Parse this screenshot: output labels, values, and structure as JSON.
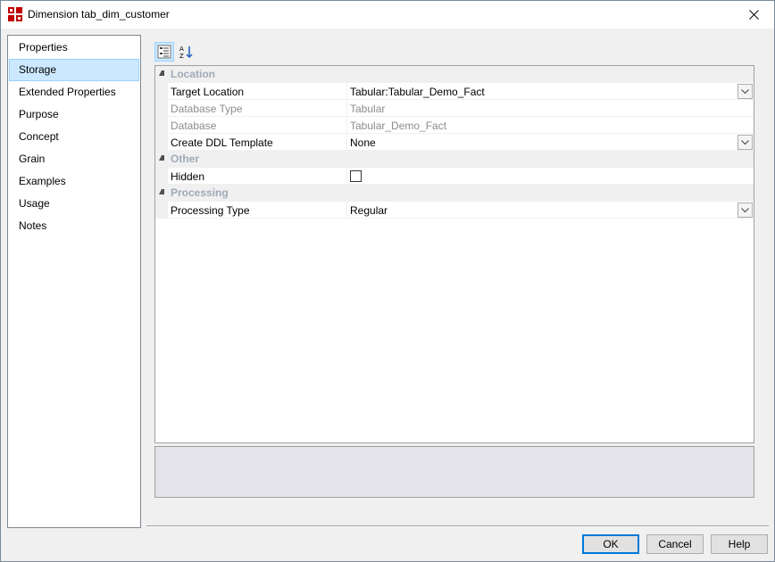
{
  "window": {
    "title": "Dimension tab_dim_customer",
    "accent_color": "#c00000"
  },
  "nav": {
    "items": [
      {
        "label": "Properties",
        "selected": false
      },
      {
        "label": "Storage",
        "selected": true
      },
      {
        "label": "Extended Properties",
        "selected": false
      },
      {
        "label": "Purpose",
        "selected": false
      },
      {
        "label": "Concept",
        "selected": false
      },
      {
        "label": "Grain",
        "selected": false
      },
      {
        "label": "Examples",
        "selected": false
      },
      {
        "label": "Usage",
        "selected": false
      },
      {
        "label": "Notes",
        "selected": false
      }
    ]
  },
  "toolbar": {
    "categorized_icon": "categorized-view-icon",
    "alphabetical_icon": "sort-alphabetical-icon"
  },
  "grid": {
    "categories": [
      {
        "label": "Location",
        "rows": [
          {
            "name": "Target Location",
            "value": "Tabular:Tabular_Demo_Fact",
            "disabled": false,
            "dropdown": true
          },
          {
            "name": "Database Type",
            "value": "Tabular",
            "disabled": true,
            "dropdown": false
          },
          {
            "name": "Database",
            "value": "Tabular_Demo_Fact",
            "disabled": true,
            "dropdown": false
          },
          {
            "name": "Create DDL Template",
            "value": "None",
            "disabled": false,
            "dropdown": true
          }
        ]
      },
      {
        "label": "Other",
        "rows": [
          {
            "name": "Hidden",
            "value": "",
            "checked": false,
            "checkbox": true
          }
        ]
      },
      {
        "label": "Processing",
        "rows": [
          {
            "name": "Processing Type",
            "value": "Regular",
            "disabled": false,
            "dropdown": true
          }
        ]
      }
    ]
  },
  "buttons": {
    "ok": "OK",
    "cancel": "Cancel",
    "help": "Help"
  }
}
